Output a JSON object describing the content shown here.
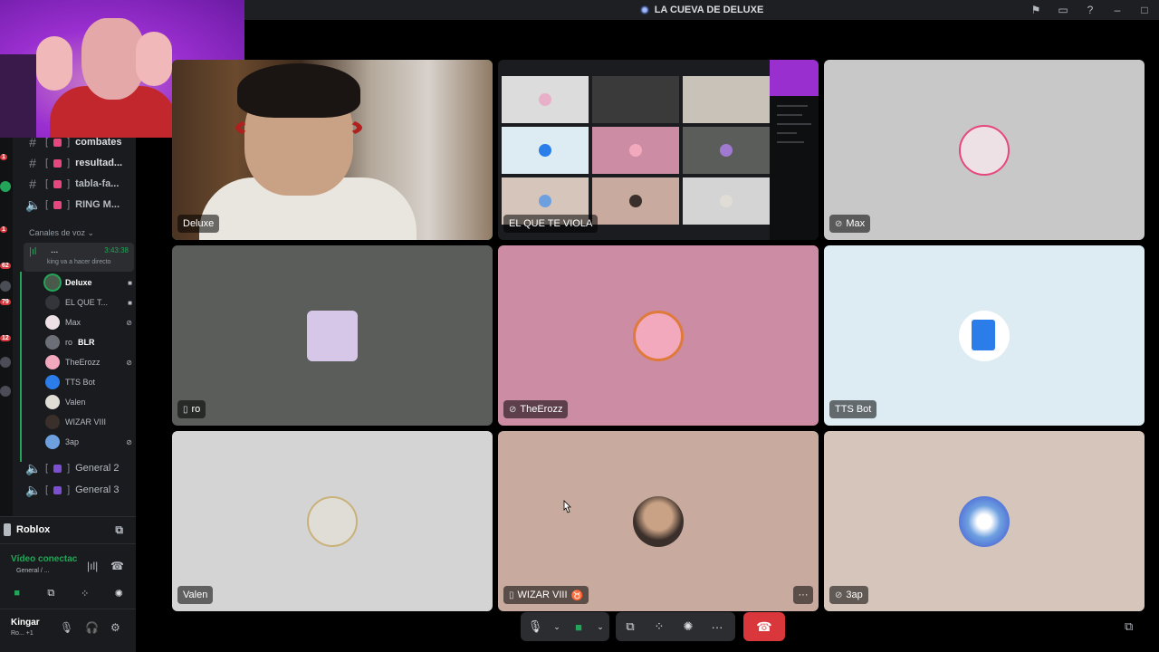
{
  "window": {
    "title": "LA CUEVA DE DELUXE"
  },
  "sidebar": {
    "text_channels": [
      {
        "name": "combates"
      },
      {
        "name": "resultad..."
      },
      {
        "name": "tabla-fa..."
      },
      {
        "name": "RING M..."
      }
    ],
    "voice_header": "Canales de voz",
    "active_voice": {
      "name": "...",
      "timer": "3:43:38",
      "status": "king va a hacer directo"
    },
    "voice_users": [
      {
        "name": "Deluxe"
      },
      {
        "name": "EL QUE T..."
      },
      {
        "name": "Max"
      },
      {
        "name": "ro",
        "tag": "BLR"
      },
      {
        "name": "TheErozz"
      },
      {
        "name": "TTS Bot"
      },
      {
        "name": "Valen"
      },
      {
        "name": "WIZAR VIII"
      },
      {
        "name": "3ap"
      }
    ],
    "other_voice": [
      {
        "name": "General 2"
      },
      {
        "name": "General 3"
      }
    ],
    "activity": "Roblox",
    "voice_connected": "Vídeo conectac",
    "voice_connected_sub": "General / ...",
    "user": {
      "name": "Kingar",
      "status": "Ro... +1"
    },
    "badges": [
      "1",
      "1",
      "62",
      "79",
      "12"
    ]
  },
  "tiles": [
    {
      "name": "Deluxe",
      "type": "camera",
      "speaking": true
    },
    {
      "name": "EL QUE TE VIOLA",
      "type": "screen"
    },
    {
      "name": "Max",
      "prefix_icon": "deafened-icon",
      "avatar_color": "#ede1e6"
    },
    {
      "name": "ro",
      "prefix_icon": "mobile-icon",
      "avatar_color": "#d6c7e8"
    },
    {
      "name": "TheErozz",
      "prefix_icon": "deafened-icon",
      "avatar_color": "#f2a9be"
    },
    {
      "name": "TTS Bot",
      "avatar_color": "#2b7de9"
    },
    {
      "name": "Valen",
      "avatar_color": "#e0dcd6"
    },
    {
      "name": "WIZAR VIII",
      "suffix": "♉",
      "prefix_icon": "mobile-icon",
      "avatar_color": "#3a2f2a"
    },
    {
      "name": "3ap",
      "prefix_icon": "deafened-icon",
      "avatar_color": "#6ea0e0"
    }
  ],
  "tile_backgrounds": [
    "#000000",
    "#1b1c1f",
    "#c8c8c8",
    "#5a5d5a",
    "#cc8ca4",
    "#dcecf2",
    "#d4d4d4",
    "#c9aa9e",
    "#d6c5ba"
  ],
  "colors": {
    "accent_green": "#23a559",
    "leave_red": "#da373c",
    "panel": "#2b2d31"
  },
  "controls": {
    "mic": "microphone-icon",
    "camera": "camera-icon",
    "share": "screen-share-icon",
    "activities": "activities-icon",
    "soundboard": "soundboard-icon",
    "more": "···",
    "leave": "phone-hangup-icon"
  }
}
